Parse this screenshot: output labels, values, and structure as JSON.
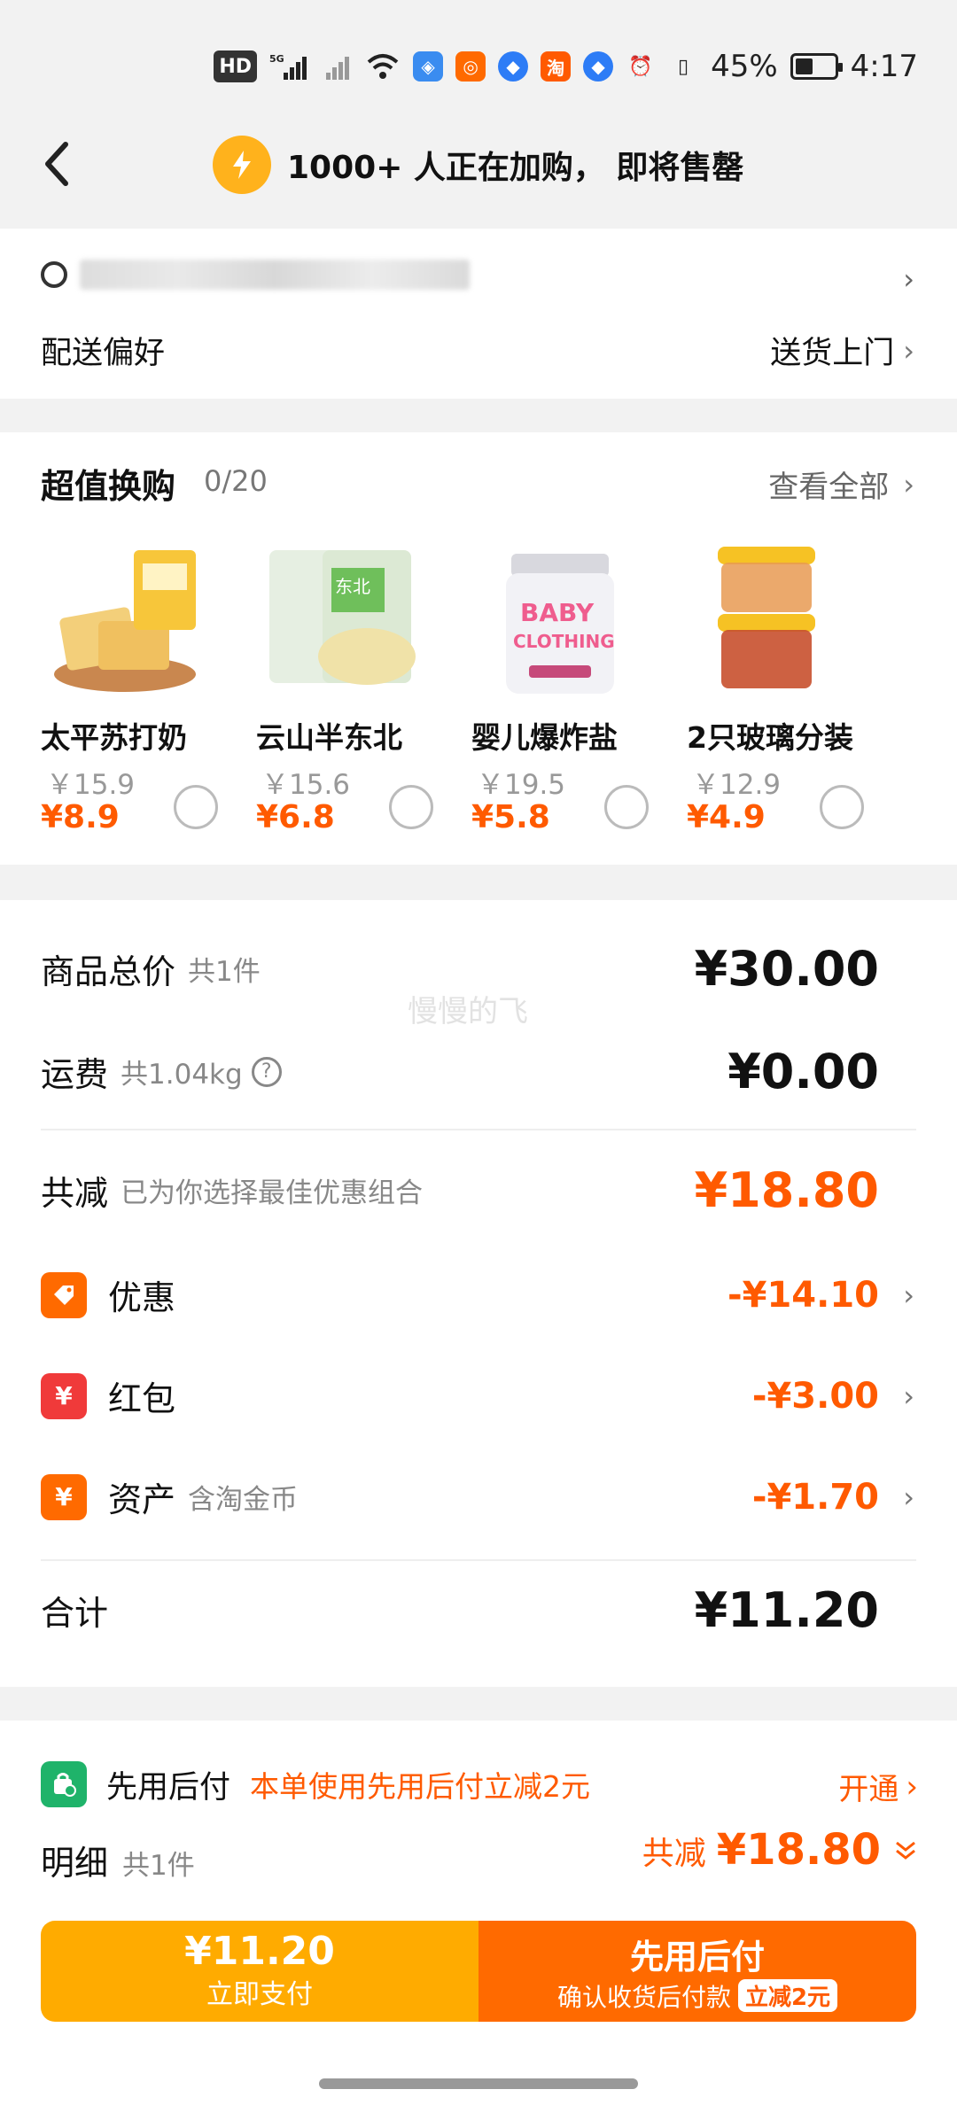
{
  "status_bar": {
    "hd": "HD",
    "net": "5G",
    "app1": "淘",
    "battery": "45%",
    "time": "4:17"
  },
  "header": {
    "banner": "1000+ 人正在加购， 即将售罄"
  },
  "address": {
    "pref_label": "配送偏好",
    "pref_value": "送货上门"
  },
  "swap": {
    "title": "超值换购",
    "count": "0/20",
    "view_all": "查看全部",
    "products": [
      {
        "name": "太平苏打奶",
        "orig": "￥15.9",
        "price": "¥8.9"
      },
      {
        "name": "云山半东北",
        "orig": "￥15.6",
        "price": "¥6.8"
      },
      {
        "name": "婴儿爆炸盐",
        "orig": "￥19.5",
        "price": "¥5.8"
      },
      {
        "name": "2只玻璃分装",
        "orig": "￥12.9",
        "price": "¥4.9"
      }
    ]
  },
  "summary": {
    "goods_label": "商品总价",
    "goods_sub": "共1件",
    "goods_value": "¥30.00",
    "shipping_label": "运费",
    "shipping_sub": "共1.04kg",
    "shipping_value": "¥0.00",
    "discount_label": "共减",
    "discount_sub": "已为你选择最佳优惠组合",
    "discount_value": "¥18.80",
    "coupon_label": "优惠",
    "coupon_value": "-¥14.10",
    "redpack_label": "红包",
    "redpack_value": "-¥3.00",
    "asset_label": "资产",
    "asset_sub": "含淘金币",
    "asset_value": "-¥1.70",
    "total_label": "合计",
    "total_value": "¥11.20",
    "watermark": "慢慢的飞"
  },
  "bottom": {
    "paylater_label": "先用后付",
    "paylater_promo": "本单使用先用后付立减2元",
    "paylater_open": "开通",
    "detail_label": "明细",
    "detail_sub": "共1件",
    "detail_discount_label": "共减",
    "detail_discount_value": "¥18.80",
    "pay_now_amount": "¥11.20",
    "pay_now_label": "立即支付",
    "pay_later_title": "先用后付",
    "pay_later_sub": "确认收货后付款",
    "pay_later_tag": "立减2元"
  },
  "colors": {
    "accent": "#ff5a00",
    "pay_now": "#ffab00",
    "pay_later": "#ff6a00"
  }
}
